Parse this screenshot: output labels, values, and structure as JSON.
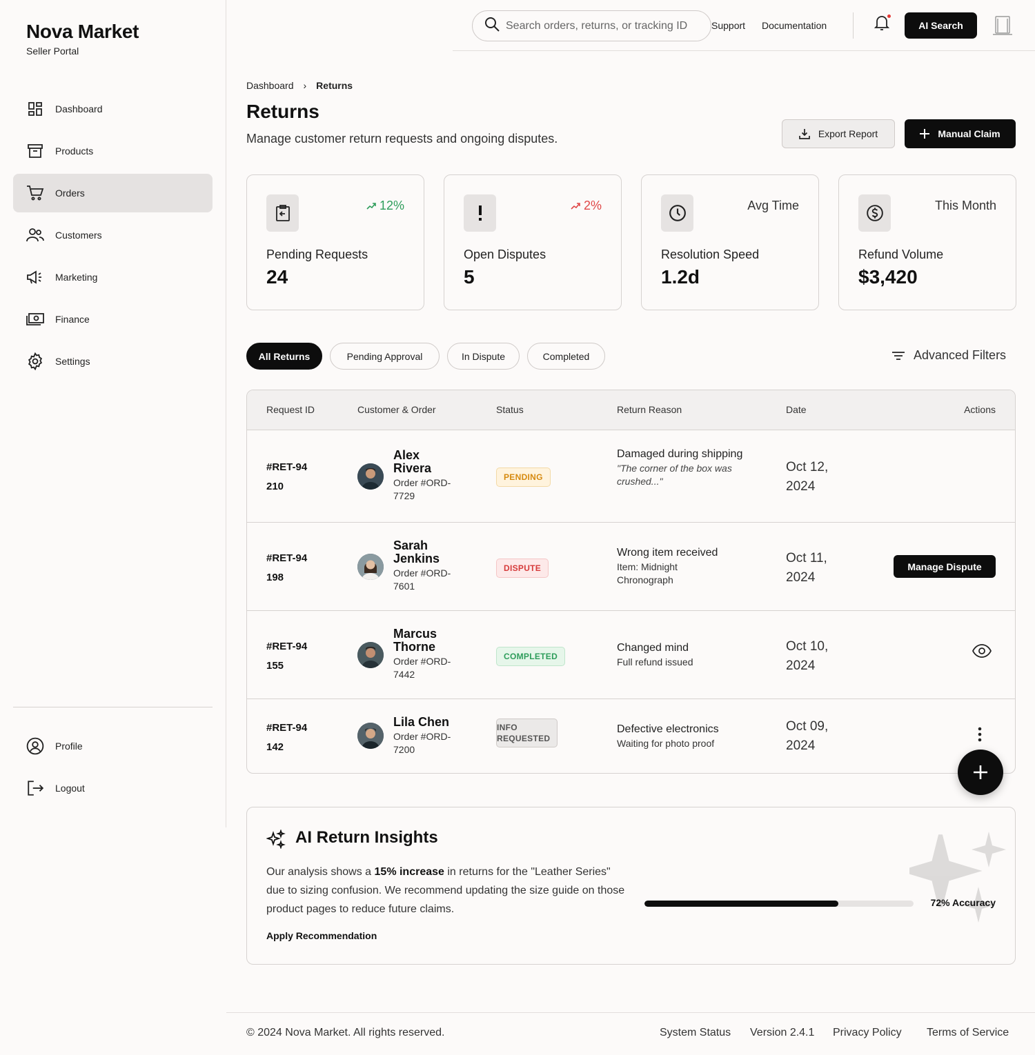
{
  "brand": {
    "name": "Nova Market",
    "subtitle": "Seller Portal"
  },
  "sidebar": {
    "items": [
      {
        "label": "Dashboard",
        "icon": "dashboard-icon",
        "active": false
      },
      {
        "label": "Products",
        "icon": "archive-icon",
        "active": false
      },
      {
        "label": "Orders",
        "icon": "cart-icon",
        "active": true
      },
      {
        "label": "Customers",
        "icon": "users-icon",
        "active": false
      },
      {
        "label": "Marketing",
        "icon": "megaphone-icon",
        "active": false
      },
      {
        "label": "Finance",
        "icon": "cash-icon",
        "active": false
      },
      {
        "label": "Settings",
        "icon": "gear-icon",
        "active": false
      }
    ],
    "bottom": [
      {
        "label": "Profile",
        "icon": "profile-icon"
      },
      {
        "label": "Logout",
        "icon": "logout-icon"
      }
    ]
  },
  "topbar": {
    "search_placeholder": "Search orders, returns, or tracking ID",
    "links": [
      "Support",
      "Documentation"
    ],
    "ai_search_label": "AI Search"
  },
  "header": {
    "breadcrumb": [
      "Dashboard",
      "Returns"
    ],
    "title": "Returns",
    "subtitle": "Manage customer return requests and ongoing disputes.",
    "export_label": "Export Report",
    "manual_label": "Manual Claim"
  },
  "stats": [
    {
      "label": "Pending Requests",
      "value": "24",
      "corner": "12%",
      "corner_type": "trend-up-green",
      "icon": "clipboard-return-icon"
    },
    {
      "label": "Open Disputes",
      "value": "5",
      "corner": "2%",
      "corner_type": "trend-up-red",
      "icon": "exclamation-icon"
    },
    {
      "label": "Resolution Speed",
      "value": "1.2d",
      "corner": "Avg Time",
      "corner_type": "text",
      "icon": "clock-icon"
    },
    {
      "label": "Refund Volume",
      "value": "$3,420",
      "corner": "This Month",
      "corner_type": "text",
      "icon": "dollar-circle-icon"
    }
  ],
  "tabs": [
    "All Returns",
    "Pending Approval",
    "In Dispute",
    "Completed"
  ],
  "advanced_filters_label": "Advanced Filters",
  "table": {
    "columns": [
      "Request ID",
      "Customer & Order",
      "Status",
      "Return Reason",
      "Date",
      "Actions"
    ],
    "rows": [
      {
        "id": "#RET-94210",
        "first": "Alex",
        "last": "Rivera",
        "order": "Order #ORD-7729",
        "status": "PENDING",
        "status_type": "pending",
        "reason": "Damaged during shipping",
        "reason_sub": "\"The corner of the box was crushed...\"",
        "reason_italic": true,
        "date_line1": "Oct 12,",
        "date_line2": "2024",
        "action": "none"
      },
      {
        "id": "#RET-94198",
        "first": "Sarah",
        "last": "Jenkins",
        "order": "Order #ORD-7601",
        "status": "DISPUTE",
        "status_type": "dispute",
        "reason": "Wrong item received",
        "reason_sub": "Item: Midnight Chronograph",
        "reason_italic": false,
        "date_line1": "Oct 11,",
        "date_line2": "2024",
        "action": "Manage Dispute"
      },
      {
        "id": "#RET-94155",
        "first": "Marcus",
        "last": "Thorne",
        "order": "Order #ORD-7442",
        "status": "COMPLETED",
        "status_type": "completed",
        "reason": "Changed mind",
        "reason_sub": "Full refund issued",
        "reason_italic": false,
        "date_line1": "Oct 10,",
        "date_line2": "2024",
        "action": "eye-icon"
      },
      {
        "id": "#RET-94142",
        "first": "Lila",
        "last": "Chen",
        "order": "Order #ORD-7200",
        "status": "INFO REQUESTED",
        "status_type": "info",
        "reason": "Defective electronics",
        "reason_sub": "Waiting for photo proof",
        "reason_italic": false,
        "date_line1": "Oct 09,",
        "date_line2": "2024",
        "action": "more-vertical-icon"
      }
    ]
  },
  "insights": {
    "title": "AI Return Insights",
    "text_before": "Our analysis shows a ",
    "text_bold": "15% increase",
    "text_after": " in returns for the \"Leather Series\" due to sizing confusion. We recommend updating the size guide on those product pages to reduce future claims.",
    "apply_label": "Apply Recommendation",
    "accuracy_label": "72% Accuracy",
    "accuracy_value": 0.72
  },
  "footer": {
    "copyright": "© 2024 Nova Market. All rights reserved.",
    "links": [
      "System Status",
      "Version 2.4.1",
      "Privacy Policy",
      "Terms of Service"
    ]
  }
}
